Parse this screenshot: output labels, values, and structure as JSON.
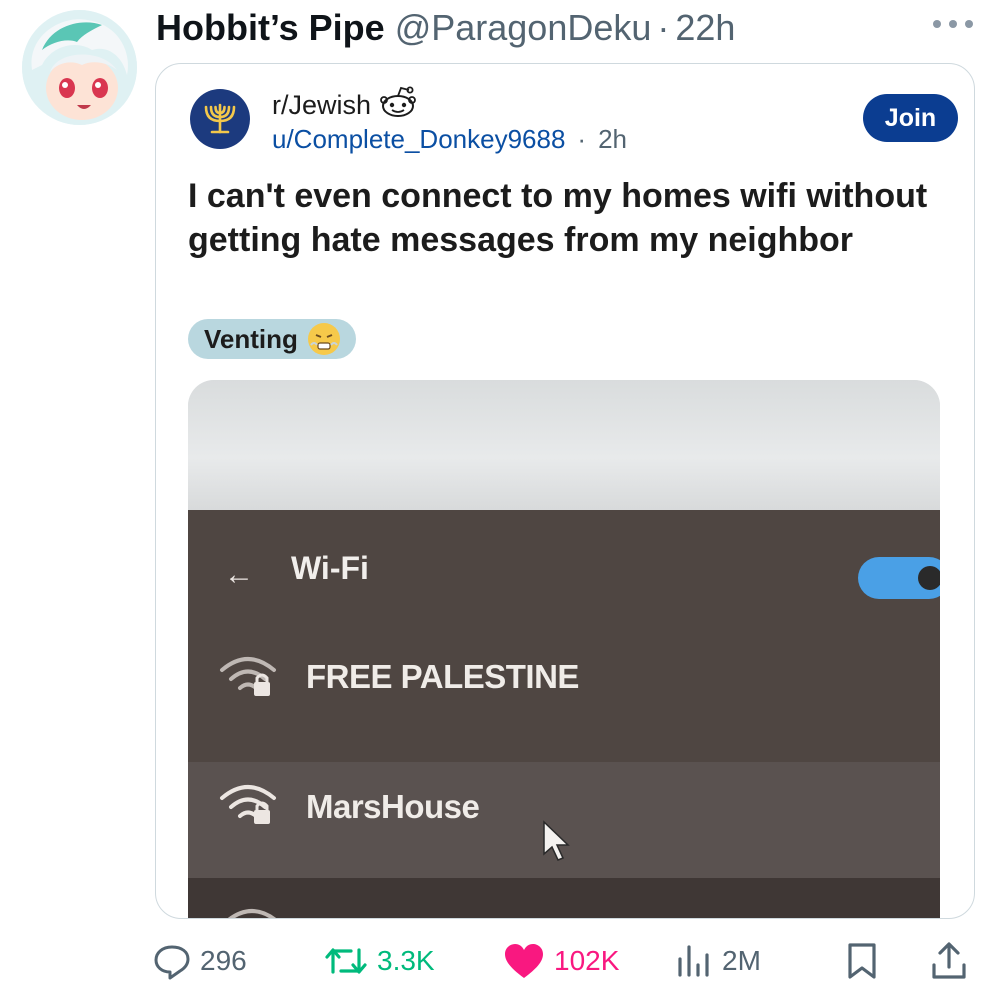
{
  "tweet": {
    "display_name": "Hobbit’s Pipe",
    "handle": "@ParagonDeku",
    "separator": "·",
    "time": "22h"
  },
  "embed": {
    "subreddit": "r/Jewish",
    "username": "u/Complete_Donkey9688",
    "separator": "·",
    "age": "2h",
    "join_label": "Join",
    "title": "I can't even connect to my homes wifi without getting hate messages from my neighbor",
    "flair": "Venting"
  },
  "photo": {
    "back_arrow": "←",
    "header": "Wi-Fi",
    "toggle_on": true,
    "networks": [
      "FREE PALESTINE",
      "MarsHouse"
    ]
  },
  "actions": {
    "replies": "296",
    "reposts": "3.3K",
    "likes": "102K",
    "views": "2M"
  },
  "colors": {
    "join_bg": "#0b3d91",
    "like": "#f91880",
    "repost": "#00ba7c",
    "toggle": "#4aa0e6"
  },
  "icons": [
    "more-icon",
    "reddit-snoo-icon",
    "menorah-icon",
    "wifi-lock-icon",
    "cursor-icon",
    "reply-icon",
    "repost-icon",
    "heart-icon",
    "views-icon",
    "bookmark-icon",
    "share-icon"
  ]
}
